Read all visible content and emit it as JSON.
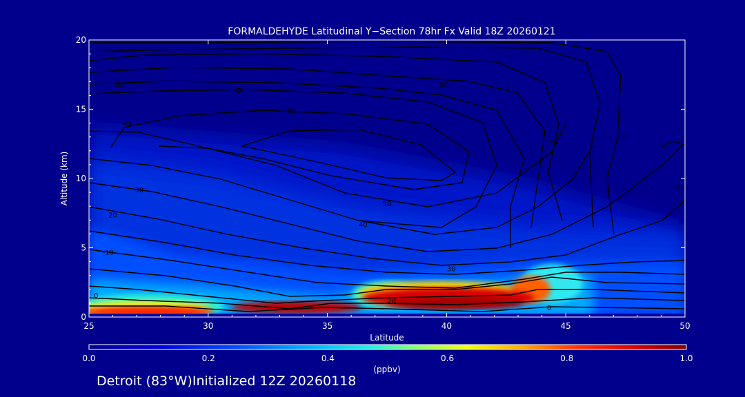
{
  "chart_data": {
    "type": "heatmap",
    "title": "FORMALDEHYDE Latitudinal Y−Section 78hr  Fx Valid 18Z 20260121",
    "xlabel": "Latitude",
    "ylabel": "Altitude (km)",
    "xlim": [
      25,
      50
    ],
    "ylim": [
      0,
      20
    ],
    "x_ticks": [
      "25",
      "30",
      "35",
      "40",
      "45",
      "50"
    ],
    "y_ticks": [
      "0",
      "5",
      "10",
      "15",
      "20"
    ],
    "colorbar": {
      "label": "(ppbv)",
      "ticks": [
        "0.0",
        "0.2",
        "0.4",
        "0.6",
        "0.8",
        "1.0"
      ],
      "range": [
        0.0,
        1.0
      ]
    },
    "contour_labels": [
      "-10",
      "0",
      "10",
      "20",
      "30",
      "40",
      "50"
    ],
    "colors": {
      "background": "#00008c",
      "axis": "#ffffff",
      "contour": "#000000"
    },
    "grid": false
  },
  "footer": "Detroit (83°W)Initialized 12Z 20260118"
}
